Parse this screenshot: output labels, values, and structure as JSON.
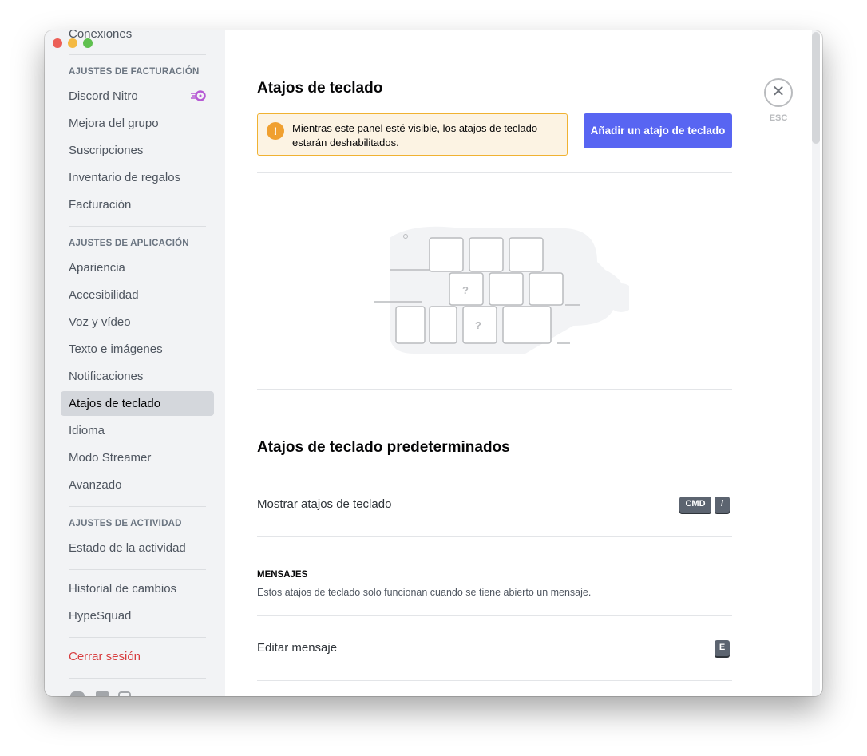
{
  "sidebar": {
    "top_item": "Conexiones",
    "billing_header": "AJUSTES DE FACTURACIÓN",
    "billing": [
      "Discord Nitro",
      "Mejora del grupo",
      "Suscripciones",
      "Inventario de regalos",
      "Facturación"
    ],
    "app_header": "AJUSTES DE APLICACIÓN",
    "app": [
      "Apariencia",
      "Accesibilidad",
      "Voz y vídeo",
      "Texto e imágenes",
      "Notificaciones",
      "Atajos de teclado",
      "Idioma",
      "Modo Streamer",
      "Avanzado"
    ],
    "selected": "Atajos de teclado",
    "activity_header": "AJUSTES DE ACTIVIDAD",
    "activity": [
      "Estado de la actividad"
    ],
    "misc": [
      "Historial de cambios",
      "HypeSquad"
    ],
    "logout": "Cerrar sesión",
    "social_icons": [
      "twitter-icon",
      "facebook-icon",
      "instagram-icon"
    ]
  },
  "main": {
    "title": "Atajos de teclado",
    "warning": "Mientras este panel esté visible, los atajos de teclado estarán deshabilitados.",
    "add_button": "Añadir un atajo de teclado",
    "defaults_title": "Atajos de teclado predeterminados",
    "shortcuts": [
      {
        "label": "Mostrar atajos de teclado",
        "keys": [
          "CMD",
          "/"
        ]
      }
    ],
    "messages_header": "MENSAJES",
    "messages_desc": "Estos atajos de teclado solo funcionan cuando se tiene abierto un mensaje.",
    "message_shortcuts": [
      {
        "label": "Editar mensaje",
        "keys": [
          "E"
        ]
      }
    ],
    "close_label": "ESC"
  },
  "colors": {
    "accent": "#5865f2",
    "danger": "#d83c3e",
    "warning": "#f0b232",
    "nitro": "#b659d4"
  }
}
